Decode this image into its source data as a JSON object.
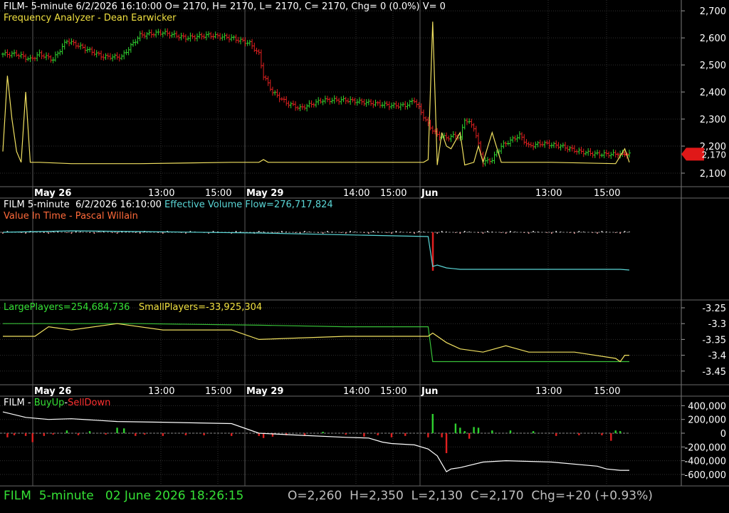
{
  "header1": {
    "symbol_line": "FILM- 5-minute 6/2/2026 16:10:00 O= 2170, H= 2170, L= 2170, C= 2170, Chg= 0 (0.0%) V= 0",
    "indicator": "Frequency Analyzer - Dean Earwicker"
  },
  "header2": {
    "symbol_line": "FILM 5-minute  6/2/2026 16:10:00",
    "flow_label": "Effective Volume Flow=276,717,824",
    "indicator": "Value In Time - Pascal Willain"
  },
  "header3": {
    "large": "LargePlayers=254,684,736",
    "small": "SmallPlayers=-33,925,304"
  },
  "header4": {
    "prefix": "FILM - ",
    "buy": "BuyUp",
    "dash": "-",
    "sell": "SellDown"
  },
  "footer": {
    "symbol": "FILM",
    "interval": "5-minute",
    "datetime": "02 June 2026 18:26:15",
    "ohlc": "O=2,260  H=2,350  L=2,130  C=2,170  Chg=+20 (+0.93%)"
  },
  "colors": {
    "up": "#2fd02f",
    "down": "#e02020",
    "yellow": "#f0e060",
    "cyan": "#5ad6d6",
    "green": "#38c038",
    "white": "#ffffff",
    "grid": "#4a4a4a"
  },
  "chart_data": [
    {
      "type": "bar",
      "panel": "price",
      "title": "",
      "xlabel": "",
      "ylabel": "",
      "x_ticks": [
        "May 26",
        "13:00",
        "15:00",
        "May 29",
        "14:00",
        "15:00",
        "Jun",
        "13:00",
        "15:00"
      ],
      "yticks": [
        "2,700",
        "2,600",
        "2,500",
        "2,400",
        "2,300",
        "2,200",
        "2,100"
      ],
      "ylim": [
        2050,
        2740
      ],
      "last_price_label": "2,170",
      "series": [
        {
          "name": "FILM",
          "close_path": [
            [
              0,
              2540
            ],
            [
              6,
              2540
            ],
            [
              12,
              2520
            ],
            [
              16,
              2540
            ],
            [
              22,
              2520
            ],
            [
              28,
              2590
            ],
            [
              36,
              2560
            ],
            [
              44,
              2530
            ],
            [
              52,
              2530
            ],
            [
              60,
              2610
            ],
            [
              70,
              2620
            ],
            [
              80,
              2600
            ],
            [
              90,
              2610
            ],
            [
              100,
              2600
            ],
            [
              108,
              2580
            ],
            [
              112,
              2540
            ],
            [
              114,
              2460
            ],
            [
              118,
              2400
            ],
            [
              124,
              2360
            ],
            [
              130,
              2340
            ],
            [
              140,
              2370
            ],
            [
              150,
              2370
            ],
            [
              160,
              2360
            ],
            [
              170,
              2350
            ],
            [
              176,
              2350
            ],
            [
              180,
              2370
            ],
            [
              186,
              2280
            ],
            [
              190,
              2240
            ],
            [
              194,
              2230
            ],
            [
              198,
              2240
            ],
            [
              200,
              2230
            ],
            [
              202,
              2300
            ],
            [
              206,
              2270
            ],
            [
              210,
              2140
            ],
            [
              214,
              2150
            ],
            [
              218,
              2200
            ],
            [
              222,
              2220
            ],
            [
              226,
              2240
            ],
            [
              230,
              2200
            ],
            [
              236,
              2210
            ],
            [
              244,
              2200
            ],
            [
              252,
              2180
            ],
            [
              260,
              2170
            ],
            [
              268,
              2170
            ],
            [
              274,
              2170
            ]
          ]
        },
        {
          "name": "Frequency Analyzer",
          "values": [
            [
              0,
              2180
            ],
            [
              2,
              2460
            ],
            [
              4,
              2300
            ],
            [
              6,
              2180
            ],
            [
              8,
              2140
            ],
            [
              10,
              2400
            ],
            [
              12,
              2140
            ],
            [
              16,
              2140
            ],
            [
              30,
              2135
            ],
            [
              60,
              2135
            ],
            [
              100,
              2140
            ],
            [
              112,
              2140
            ],
            [
              114,
              2150
            ],
            [
              116,
              2140
            ],
            [
              150,
              2140
            ],
            [
              176,
              2140
            ],
            [
              184,
              2140
            ],
            [
              186,
              2150
            ],
            [
              188,
              2660
            ],
            [
              190,
              2130
            ],
            [
              192,
              2250
            ],
            [
              194,
              2200
            ],
            [
              196,
              2190
            ],
            [
              200,
              2250
            ],
            [
              202,
              2130
            ],
            [
              206,
              2140
            ],
            [
              208,
              2200
            ],
            [
              210,
              2140
            ],
            [
              214,
              2250
            ],
            [
              218,
              2140
            ],
            [
              240,
              2140
            ],
            [
              268,
              2135
            ],
            [
              272,
              2190
            ],
            [
              274,
              2140
            ]
          ]
        }
      ]
    },
    {
      "type": "line",
      "panel": "volume_flow",
      "series": [
        {
          "name": "Effective Volume Flow",
          "values": [
            [
              0,
              0
            ],
            [
              30,
              2
            ],
            [
              60,
              1
            ],
            [
              112,
              -1
            ],
            [
              186,
              -6
            ],
            [
              188,
              -48
            ],
            [
              190,
              -46
            ],
            [
              194,
              -50
            ],
            [
              200,
              -52
            ],
            [
              230,
              -52
            ],
            [
              270,
              -52
            ],
            [
              274,
              -53
            ]
          ]
        }
      ]
    },
    {
      "type": "line",
      "panel": "players",
      "yticks": [
        "-3.25",
        "-3.3",
        "-3.35",
        "-3.4",
        "-3.45"
      ],
      "ylim": [
        -3.47,
        -3.23
      ],
      "series": [
        {
          "name": "LargePlayers",
          "values": [
            [
              0,
              -3.3
            ],
            [
              30,
              -3.3
            ],
            [
              60,
              -3.3
            ],
            [
              112,
              -3.305
            ],
            [
              150,
              -3.31
            ],
            [
              186,
              -3.31
            ],
            [
              188,
              -3.42
            ],
            [
              194,
              -3.42
            ],
            [
              200,
              -3.42
            ],
            [
              210,
              -3.42
            ],
            [
              250,
              -3.42
            ],
            [
              274,
              -3.42
            ]
          ]
        },
        {
          "name": "SmallPlayers",
          "values": [
            [
              0,
              -3.34
            ],
            [
              14,
              -3.34
            ],
            [
              20,
              -3.31
            ],
            [
              30,
              -3.32
            ],
            [
              50,
              -3.3
            ],
            [
              70,
              -3.32
            ],
            [
              100,
              -3.32
            ],
            [
              112,
              -3.35
            ],
            [
              150,
              -3.34
            ],
            [
              186,
              -3.34
            ],
            [
              188,
              -3.33
            ],
            [
              194,
              -3.36
            ],
            [
              200,
              -3.38
            ],
            [
              210,
              -3.39
            ],
            [
              220,
              -3.37
            ],
            [
              230,
              -3.39
            ],
            [
              250,
              -3.39
            ],
            [
              268,
              -3.41
            ],
            [
              270,
              -3.42
            ],
            [
              272,
              -3.4
            ],
            [
              274,
              -3.4
            ]
          ]
        }
      ]
    },
    {
      "type": "bar",
      "panel": "buyup_selldown",
      "yticks": [
        "400,000",
        "200,000",
        "0",
        "-200,000",
        "-400,000",
        "-600,000"
      ],
      "ylim": [
        -680000,
        420000
      ],
      "bars": [
        [
          2,
          -60000
        ],
        [
          5,
          -30000
        ],
        [
          10,
          -40000
        ],
        [
          13,
          -130000
        ],
        [
          18,
          -40000
        ],
        [
          22,
          -20000
        ],
        [
          28,
          40000
        ],
        [
          33,
          -30000
        ],
        [
          38,
          30000
        ],
        [
          45,
          -20000
        ],
        [
          50,
          80000
        ],
        [
          53,
          70000
        ],
        [
          58,
          -40000
        ],
        [
          62,
          -20000
        ],
        [
          70,
          -40000
        ],
        [
          80,
          -30000
        ],
        [
          88,
          -30000
        ],
        [
          100,
          -40000
        ],
        [
          112,
          -40000
        ],
        [
          114,
          -70000
        ],
        [
          118,
          -50000
        ],
        [
          124,
          -30000
        ],
        [
          132,
          -40000
        ],
        [
          140,
          20000
        ],
        [
          150,
          -20000
        ],
        [
          158,
          -50000
        ],
        [
          164,
          -30000
        ],
        [
          170,
          -60000
        ],
        [
          176,
          -40000
        ],
        [
          186,
          -60000
        ],
        [
          188,
          280000
        ],
        [
          192,
          -60000
        ],
        [
          194,
          -290000
        ],
        [
          198,
          140000
        ],
        [
          200,
          80000
        ],
        [
          202,
          30000
        ],
        [
          204,
          -80000
        ],
        [
          206,
          90000
        ],
        [
          208,
          80000
        ],
        [
          214,
          40000
        ],
        [
          222,
          40000
        ],
        [
          232,
          30000
        ],
        [
          242,
          -40000
        ],
        [
          252,
          -30000
        ],
        [
          262,
          -30000
        ],
        [
          266,
          -110000
        ],
        [
          268,
          40000
        ],
        [
          270,
          30000
        ]
      ],
      "series": [
        {
          "name": "cumulative",
          "values": [
            [
              0,
              310000
            ],
            [
              10,
              230000
            ],
            [
              20,
              200000
            ],
            [
              30,
              210000
            ],
            [
              50,
              170000
            ],
            [
              70,
              160000
            ],
            [
              100,
              140000
            ],
            [
              112,
              0
            ],
            [
              130,
              -30000
            ],
            [
              150,
              -60000
            ],
            [
              160,
              -70000
            ],
            [
              166,
              -130000
            ],
            [
              170,
              -150000
            ],
            [
              180,
              -170000
            ],
            [
              186,
              -230000
            ],
            [
              190,
              -330000
            ],
            [
              194,
              -560000
            ],
            [
              196,
              -520000
            ],
            [
              200,
              -500000
            ],
            [
              210,
              -420000
            ],
            [
              220,
              -400000
            ],
            [
              240,
              -420000
            ],
            [
              260,
              -480000
            ],
            [
              264,
              -520000
            ],
            [
              270,
              -540000
            ],
            [
              274,
              -540000
            ]
          ]
        }
      ]
    }
  ]
}
